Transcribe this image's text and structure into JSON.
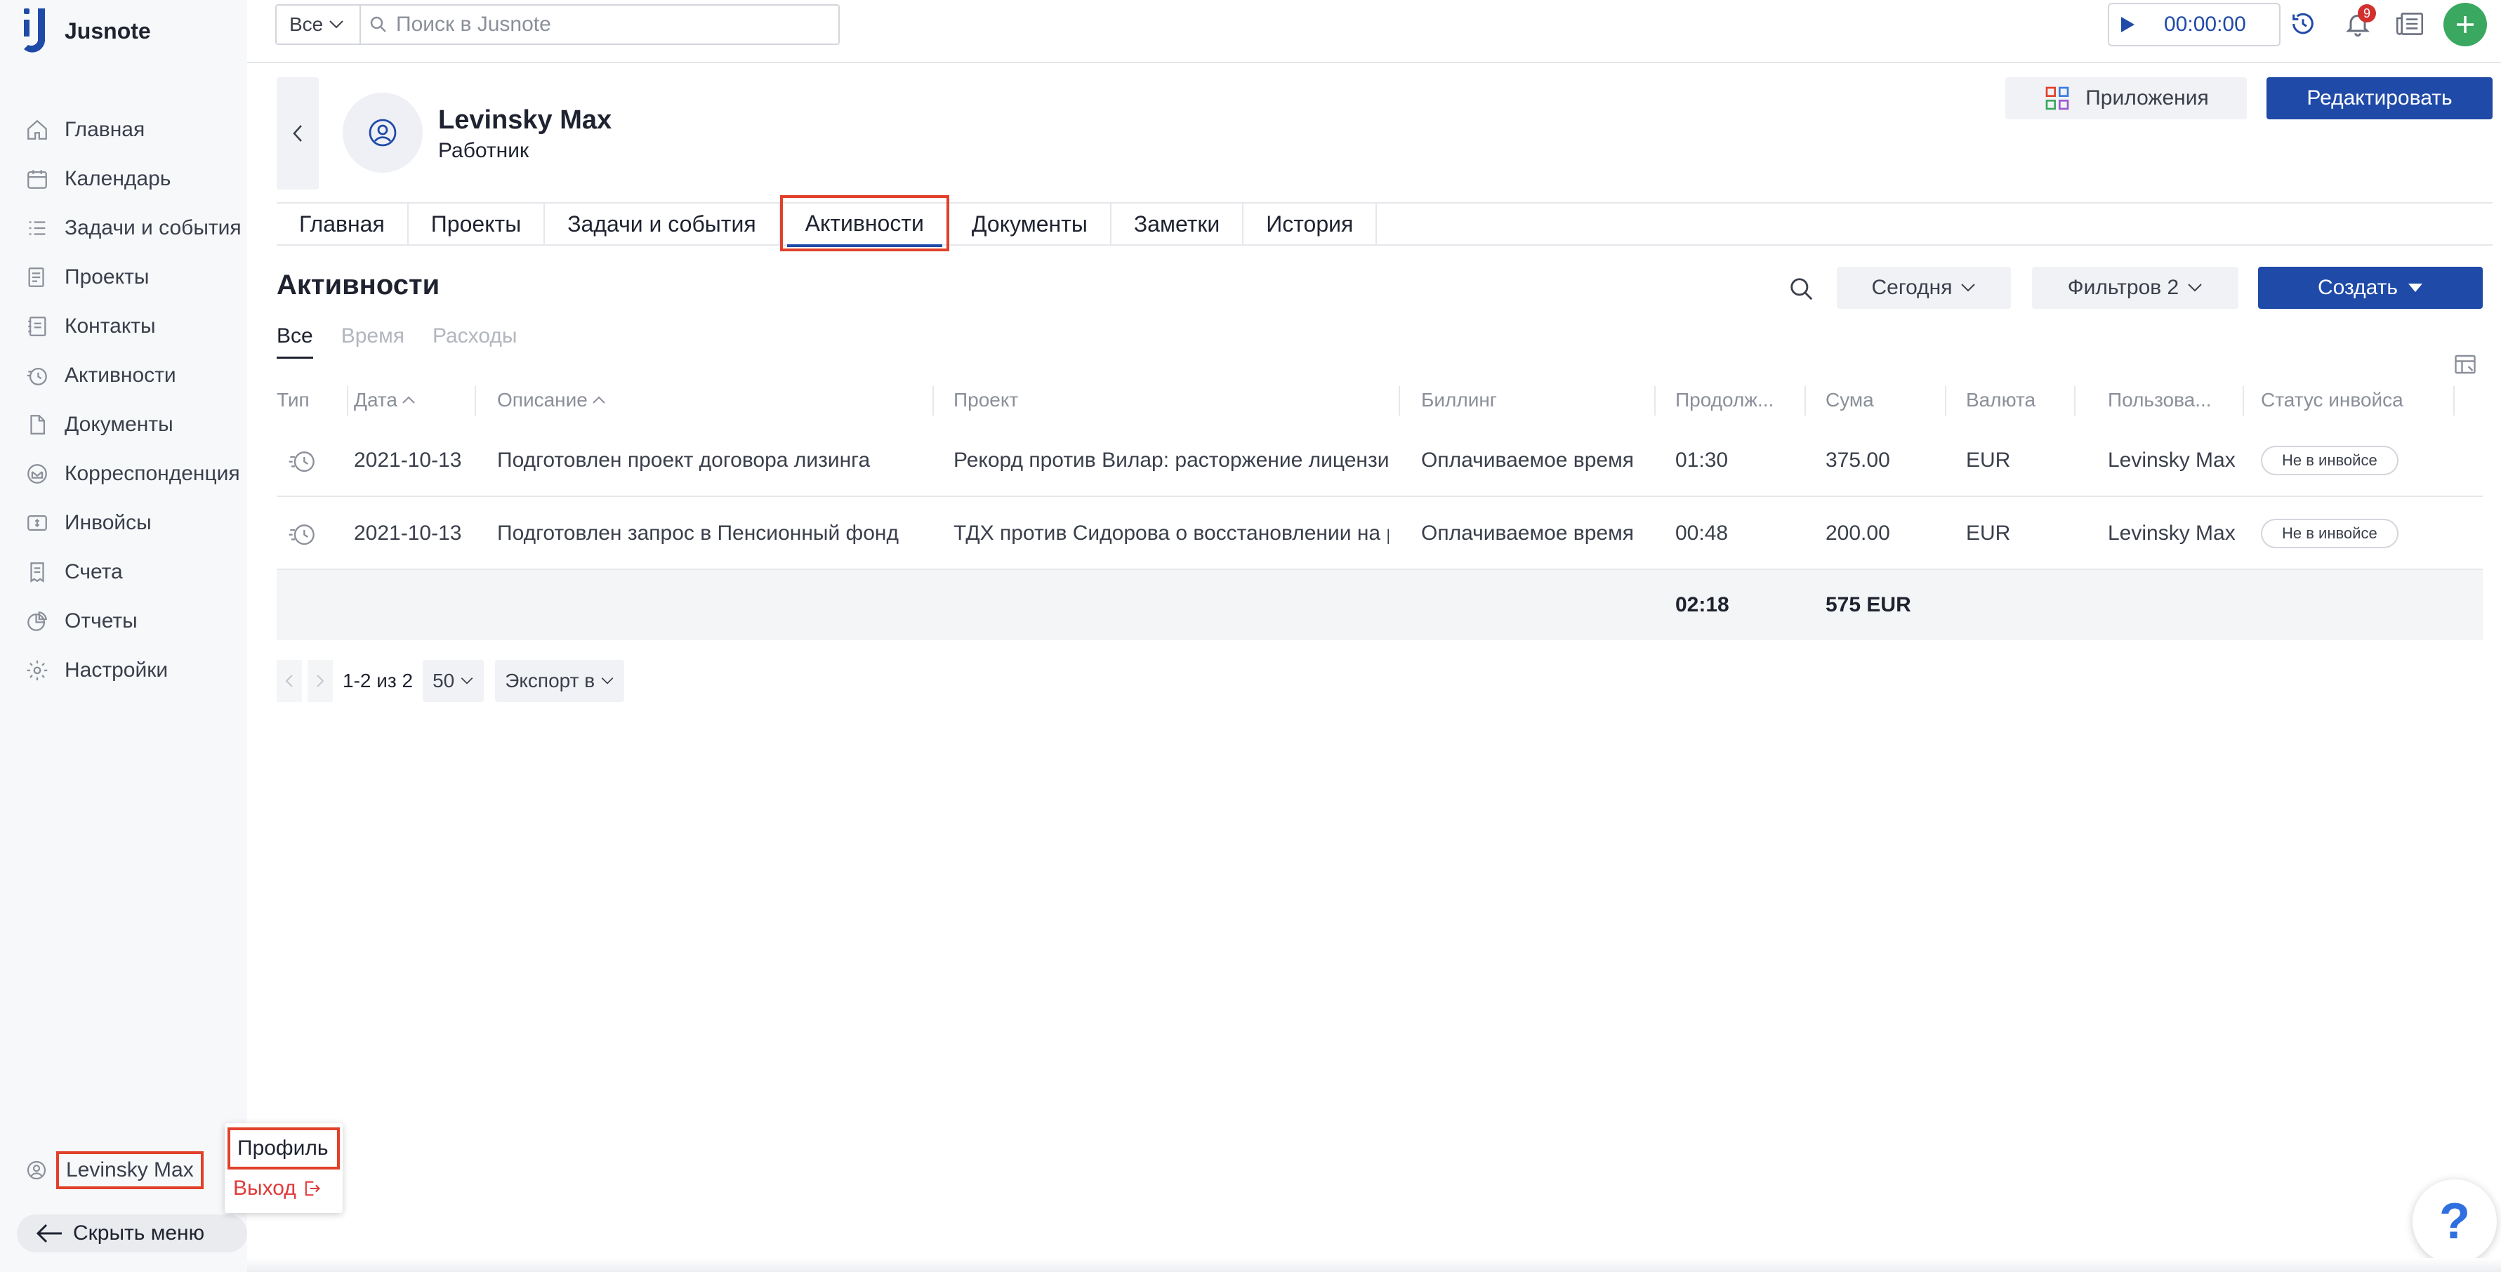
{
  "app": {
    "name": "Jusnote"
  },
  "colors": {
    "accent": "#1f4aa8",
    "highlight": "#e1402a",
    "success": "#3aa860",
    "danger": "#d32f2f"
  },
  "sidebar": {
    "items": [
      {
        "label": "Главная",
        "icon": "home-icon"
      },
      {
        "label": "Календарь",
        "icon": "calendar-icon"
      },
      {
        "label": "Задачи и события",
        "icon": "tasks-icon"
      },
      {
        "label": "Проекты",
        "icon": "projects-icon"
      },
      {
        "label": "Контакты",
        "icon": "contacts-icon"
      },
      {
        "label": "Активности",
        "icon": "activities-icon"
      },
      {
        "label": "Документы",
        "icon": "documents-icon"
      },
      {
        "label": "Корреспонденция",
        "icon": "correspondence-icon"
      },
      {
        "label": "Инвойсы",
        "icon": "invoices-icon"
      },
      {
        "label": "Счета",
        "icon": "accounts-icon"
      },
      {
        "label": "Отчеты",
        "icon": "reports-icon"
      },
      {
        "label": "Настройки",
        "icon": "settings-icon"
      }
    ],
    "user_name": "Levinsky Max",
    "hide_menu": "Скрыть меню"
  },
  "user_menu": {
    "profile": "Профиль",
    "logout": "Выход"
  },
  "topbar": {
    "scope": "Все",
    "search_placeholder": "Поиск в Jusnote",
    "timer": "00:00:00",
    "notifications_count": "9"
  },
  "header": {
    "name": "Levinsky Max",
    "role": "Работник",
    "apps_label": "Приложения",
    "edit_label": "Редактировать"
  },
  "tabs": [
    {
      "label": "Главная",
      "active": false
    },
    {
      "label": "Проекты",
      "active": false
    },
    {
      "label": "Задачи и события",
      "active": false
    },
    {
      "label": "Активности",
      "active": true
    },
    {
      "label": "Документы",
      "active": false
    },
    {
      "label": "Заметки",
      "active": false
    },
    {
      "label": "История",
      "active": false
    }
  ],
  "section": {
    "title": "Активности",
    "period": "Сегодня",
    "filters": "Фильтров 2",
    "create": "Создать",
    "subtabs": [
      "Все",
      "Время",
      "Расходы"
    ]
  },
  "table": {
    "columns": [
      "Тип",
      "Дата",
      "Описание",
      "Проект",
      "Биллинг",
      "Продолж...",
      "Сума",
      "Валюта",
      "Пользова...",
      "Статус инвойса"
    ],
    "rows": [
      {
        "date": "2021-10-13",
        "description": "Подготовлен проект договора лизинга",
        "project": "Рекорд против Вилар: расторжение лицензионного",
        "billing": "Оплачиваемое время",
        "duration": "01:30",
        "amount": "375.00",
        "currency": "EUR",
        "user": "Levinsky Max",
        "status": "Не в инвойсе"
      },
      {
        "date": "2021-10-13",
        "description": "Подготовлен запрос в Пенсионный фонд",
        "project": "ТДХ против Сидорова о восстановлении на работе",
        "billing": "Оплачиваемое время",
        "duration": "00:48",
        "amount": "200.00",
        "currency": "EUR",
        "user": "Levinsky Max",
        "status": "Не в инвойсе"
      }
    ],
    "totals": {
      "duration": "02:18",
      "amount": "575 EUR"
    }
  },
  "pagination": {
    "range": "1-2 из 2",
    "page_size": "50",
    "export": "Экспорт в"
  },
  "help": {
    "label": "?"
  }
}
